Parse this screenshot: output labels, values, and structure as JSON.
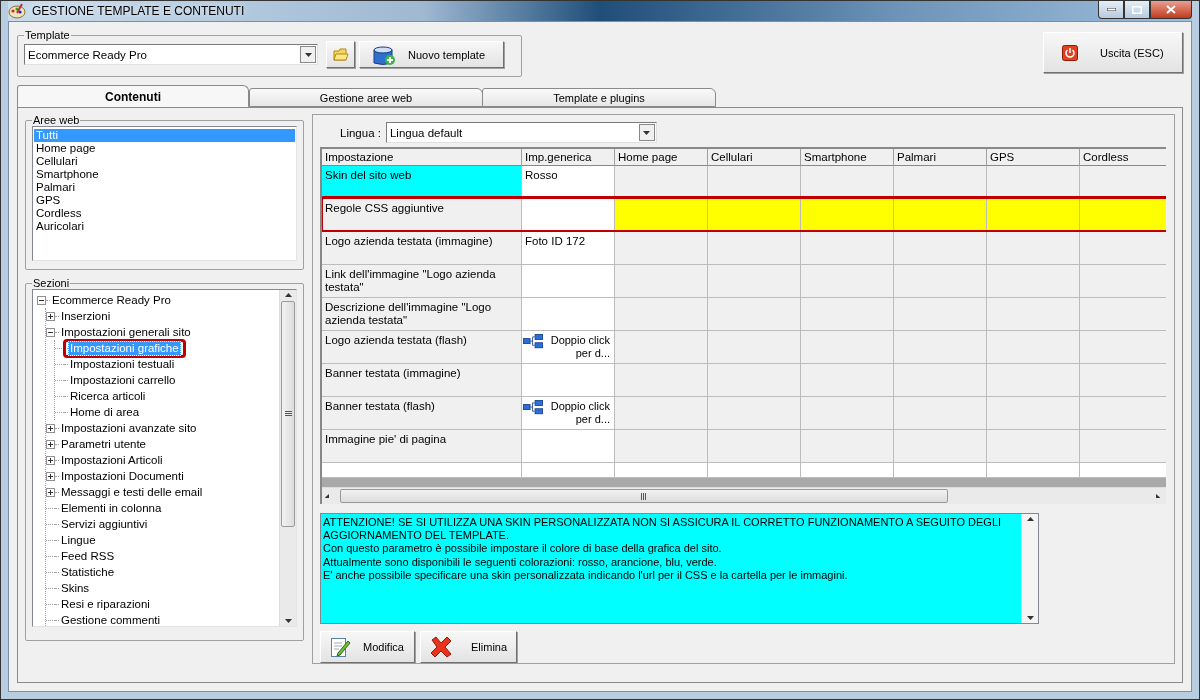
{
  "window": {
    "title": "GESTIONE TEMPLATE E CONTENUTI"
  },
  "template": {
    "label": "Template",
    "value": "Ecommerce Ready Pro",
    "new_button": "Nuovo template"
  },
  "exit_button": "Uscita (ESC)",
  "tabs": [
    {
      "label": "Contenuti",
      "selected": true
    },
    {
      "label": "Gestione aree web",
      "selected": false
    },
    {
      "label": "Template e plugins",
      "selected": false
    }
  ],
  "aree_web": {
    "label": "Aree web",
    "items": [
      {
        "label": "Tutti",
        "selected": true
      },
      {
        "label": "Home page",
        "selected": false
      },
      {
        "label": "Cellulari",
        "selected": false
      },
      {
        "label": "Smartphone",
        "selected": false
      },
      {
        "label": "Palmari",
        "selected": false
      },
      {
        "label": "GPS",
        "selected": false
      },
      {
        "label": "Cordless",
        "selected": false
      },
      {
        "label": "Auricolari",
        "selected": false
      }
    ]
  },
  "sezioni": {
    "label": "Sezioni",
    "tree": [
      {
        "label": "Ecommerce Ready Pro",
        "kind": "branch",
        "expanded": true,
        "selected": false,
        "annotated": false,
        "children": [
          {
            "label": "Inserzioni",
            "kind": "branch",
            "expanded": false,
            "selected": false,
            "annotated": false
          },
          {
            "label": "Impostazioni generali sito",
            "kind": "branch",
            "expanded": true,
            "selected": false,
            "annotated": false,
            "children": [
              {
                "label": "Impostazioni grafiche",
                "kind": "leaf",
                "selected": true,
                "annotated": true
              },
              {
                "label": "Impostazioni testuali",
                "kind": "leaf",
                "selected": false,
                "annotated": false
              },
              {
                "label": "Impostazioni carrello",
                "kind": "leaf",
                "selected": false,
                "annotated": false
              },
              {
                "label": "Ricerca articoli",
                "kind": "leaf",
                "selected": false,
                "annotated": false
              },
              {
                "label": "Home di area",
                "kind": "leaf",
                "selected": false,
                "annotated": false
              }
            ]
          },
          {
            "label": "Impostazioni avanzate sito",
            "kind": "branch",
            "expanded": false,
            "selected": false,
            "annotated": false
          },
          {
            "label": "Parametri utente",
            "kind": "branch",
            "expanded": false,
            "selected": false,
            "annotated": false
          },
          {
            "label": "Impostazioni Articoli",
            "kind": "branch",
            "expanded": false,
            "selected": false,
            "annotated": false
          },
          {
            "label": "Impostazioni Documenti",
            "kind": "branch",
            "expanded": false,
            "selected": false,
            "annotated": false
          },
          {
            "label": "Messaggi e testi delle email",
            "kind": "branch",
            "expanded": false,
            "selected": false,
            "annotated": false
          },
          {
            "label": "Elementi in colonna",
            "kind": "leaf",
            "selected": false,
            "annotated": false
          },
          {
            "label": "Servizi aggiuntivi",
            "kind": "leaf",
            "selected": false,
            "annotated": false
          },
          {
            "label": "Lingue",
            "kind": "leaf",
            "selected": false,
            "annotated": false
          },
          {
            "label": "Feed RSS",
            "kind": "leaf",
            "selected": false,
            "annotated": false
          },
          {
            "label": "Statistiche",
            "kind": "leaf",
            "selected": false,
            "annotated": false
          },
          {
            "label": "Skins",
            "kind": "leaf",
            "selected": false,
            "annotated": false
          },
          {
            "label": "Resi e riparazioni",
            "kind": "leaf",
            "selected": false,
            "annotated": false
          },
          {
            "label": "Gestione commenti",
            "kind": "leaf",
            "selected": false,
            "annotated": false
          }
        ]
      }
    ]
  },
  "lingua": {
    "label": "Lingua :",
    "value": "Lingua default"
  },
  "grid": {
    "columns": [
      "Impostazione",
      "Imp.generica",
      "Home page",
      "Cellulari",
      "Smartphone",
      "Palmari",
      "GPS",
      "Cordless"
    ],
    "rows": [
      {
        "name": "Skin del sito web",
        "selected": true,
        "highlighted": false,
        "annotated": false,
        "value": {
          "kind": "text",
          "text": "Rosso"
        }
      },
      {
        "name": "Regole CSS aggiuntive",
        "selected": false,
        "highlighted": true,
        "annotated": true,
        "value": {
          "kind": "empty"
        }
      },
      {
        "name": "Logo azienda testata (immagine)",
        "selected": false,
        "highlighted": false,
        "annotated": false,
        "value": {
          "kind": "text",
          "text": "Foto ID 172"
        }
      },
      {
        "name": "Link dell'immagine \"Logo azienda testata\"",
        "selected": false,
        "highlighted": false,
        "annotated": false,
        "value": {
          "kind": "empty"
        }
      },
      {
        "name": "Descrizione dell'immagine \"Logo azienda testata\"",
        "selected": false,
        "highlighted": false,
        "annotated": false,
        "value": {
          "kind": "empty"
        }
      },
      {
        "name": "Logo azienda testata (flash)",
        "selected": false,
        "highlighted": false,
        "annotated": false,
        "value": {
          "kind": "flash",
          "text": "Doppio click per d..."
        }
      },
      {
        "name": "Banner testata (immagine)",
        "selected": false,
        "highlighted": false,
        "annotated": false,
        "value": {
          "kind": "empty"
        }
      },
      {
        "name": "Banner testata (flash)",
        "selected": false,
        "highlighted": false,
        "annotated": false,
        "value": {
          "kind": "flash",
          "text": "Doppio click per d..."
        }
      },
      {
        "name": "Immagine pie' di pagina",
        "selected": false,
        "highlighted": false,
        "annotated": false,
        "value": {
          "kind": "empty"
        }
      }
    ]
  },
  "description": [
    "ATTENZIONE! SE SI UTILIZZA UNA SKIN PERSONALIZZATA NON SI ASSICURA IL CORRETTO FUNZIONAMENTO A SEGUITO DEGLI AGGIORNAMENTO DEL TEMPLATE.",
    "Con questo parametro è possibile impostare il colore di base della grafica del sito.",
    "Attualmente sono disponibili le seguenti colorazioni: rosso, arancione, blu, verde.",
    "E' anche possibile specificare una skin personalizzata indicando l'url per il CSS e la cartella per le immagini."
  ],
  "buttons": [
    {
      "kind": "edit",
      "label": "Modifica"
    },
    {
      "kind": "delete",
      "label": "Elimina"
    }
  ]
}
